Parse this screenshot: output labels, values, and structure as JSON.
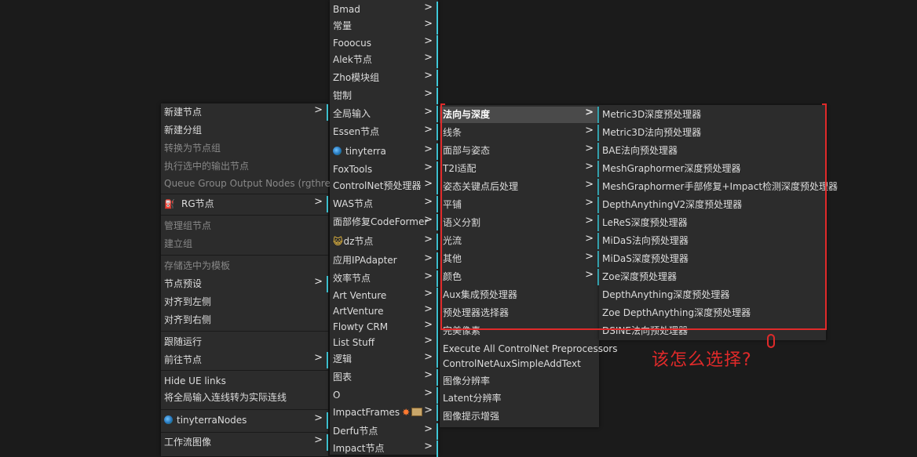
{
  "menu_main": {
    "items": [
      {
        "label": "新建节点",
        "arrow": ">",
        "disabled": false
      },
      {
        "label": "新建分组",
        "disabled": false
      },
      {
        "label": "转换为节点组",
        "disabled": true
      },
      {
        "label": "执行选中的输出节点",
        "disabled": true
      },
      {
        "label": "Queue Group Output Nodes (rgthree)",
        "disabled": true
      },
      {
        "label": "RG节点",
        "arrow": ">",
        "disabled": false
      },
      {
        "label": "管理组节点",
        "disabled": true
      },
      {
        "label": "建立组",
        "disabled": true
      },
      {
        "label": "存储选中为模板",
        "disabled": true
      },
      {
        "label": "节点预设",
        "arrow": ">",
        "disabled": false
      },
      {
        "label": "对齐到左侧",
        "disabled": false
      },
      {
        "label": "对齐到右侧",
        "disabled": false
      },
      {
        "label": "跟随运行",
        "disabled": false
      },
      {
        "label": "前往节点",
        "arrow": ">",
        "disabled": false
      },
      {
        "label": "Hide UE links",
        "disabled": false
      },
      {
        "label": "将全局输入连线转为实际连线",
        "disabled": false
      },
      {
        "label": "tinyterraNodes",
        "arrow": ">",
        "disabled": false
      },
      {
        "label": "工作流图像",
        "arrow": ">",
        "disabled": false
      }
    ]
  },
  "menu_categories": {
    "items": [
      {
        "label": "Bmad",
        "arrow": ">"
      },
      {
        "label": "常量",
        "arrow": ">"
      },
      {
        "label": "Fooocus",
        "arrow": ">"
      },
      {
        "label": "Alek节点",
        "arrow": ">"
      },
      {
        "label": "Zho模块组",
        "arrow": ">"
      },
      {
        "label": "钳制",
        "arrow": ">"
      },
      {
        "label": "全局输入",
        "arrow": ">"
      },
      {
        "label": "Essen节点",
        "arrow": ">"
      },
      {
        "label": "tinyterra",
        "arrow": ">"
      },
      {
        "label": "FoxTools",
        "arrow": ">"
      },
      {
        "label": "ControlNet预处理器",
        "arrow": ">"
      },
      {
        "label": "WAS节点",
        "arrow": ">"
      },
      {
        "label": "面部修复CodeFormer",
        "arrow": ">"
      },
      {
        "label": "dz节点",
        "arrow": ">"
      },
      {
        "label": "应用IPAdapter",
        "arrow": ">"
      },
      {
        "label": "效率节点",
        "arrow": ">"
      },
      {
        "label": "Art Venture",
        "arrow": ">"
      },
      {
        "label": "ArtVenture",
        "arrow": ">"
      },
      {
        "label": "Flowty CRM",
        "arrow": ">"
      },
      {
        "label": "List Stuff",
        "arrow": ">"
      },
      {
        "label": "逻辑",
        "arrow": ">"
      },
      {
        "label": "图表",
        "arrow": ">"
      },
      {
        "label": "O",
        "arrow": ">"
      },
      {
        "label": "ImpactFrames",
        "arrow": ">"
      },
      {
        "label": "Derfu节点",
        "arrow": ">"
      },
      {
        "label": "Impact节点",
        "arrow": ">"
      }
    ]
  },
  "menu_controlnet": {
    "items": [
      {
        "label": "法向与深度",
        "arrow": ">",
        "selected": true
      },
      {
        "label": "线条",
        "arrow": ">"
      },
      {
        "label": "面部与姿态",
        "arrow": ">"
      },
      {
        "label": "T2I适配",
        "arrow": ">"
      },
      {
        "label": "姿态关键点后处理",
        "arrow": ">"
      },
      {
        "label": "平铺",
        "arrow": ">"
      },
      {
        "label": "语义分割",
        "arrow": ">"
      },
      {
        "label": "光流",
        "arrow": ">"
      },
      {
        "label": "其他",
        "arrow": ">"
      },
      {
        "label": "颜色",
        "arrow": ">"
      },
      {
        "label": "Aux集成预处理器"
      },
      {
        "label": "预处理器选择器"
      },
      {
        "label": "完美像素"
      },
      {
        "label": "Execute All ControlNet Preprocessors"
      },
      {
        "label": "ControlNetAuxSimpleAddText"
      },
      {
        "label": "图像分辨率"
      },
      {
        "label": "Latent分辨率"
      },
      {
        "label": "图像提示增强"
      }
    ]
  },
  "menu_depth": {
    "items": [
      {
        "label": "Metric3D深度预处理器"
      },
      {
        "label": "Metric3D法向预处理器"
      },
      {
        "label": "BAE法向预处理器"
      },
      {
        "label": "MeshGraphormer深度预处理器"
      },
      {
        "label": "MeshGraphormer手部修复+Impact检测深度预处理器"
      },
      {
        "label": "DepthAnythingV2深度预处理器"
      },
      {
        "label": "LeReS深度预处理器"
      },
      {
        "label": "MiDaS法向预处理器"
      },
      {
        "label": "MiDaS深度预处理器"
      },
      {
        "label": "Zoe深度预处理器"
      },
      {
        "label": "DepthAnything深度预处理器"
      },
      {
        "label": "Zoe DepthAnything深度预处理器"
      },
      {
        "label": "DSINE法向预处理器"
      }
    ]
  },
  "annotation": {
    "text": "该怎么选择?"
  },
  "colors": {
    "accent": "#3fc8d8",
    "highlight": "#e02a2a",
    "menu_bg": "#2c2c2c",
    "canvas_bg": "#1b1b1b"
  },
  "icons": {
    "globe": "globe-icon",
    "rg": "rg-icon",
    "cat": "cat-face-icon",
    "spark": "explosion-icon",
    "box": "box-icon"
  }
}
